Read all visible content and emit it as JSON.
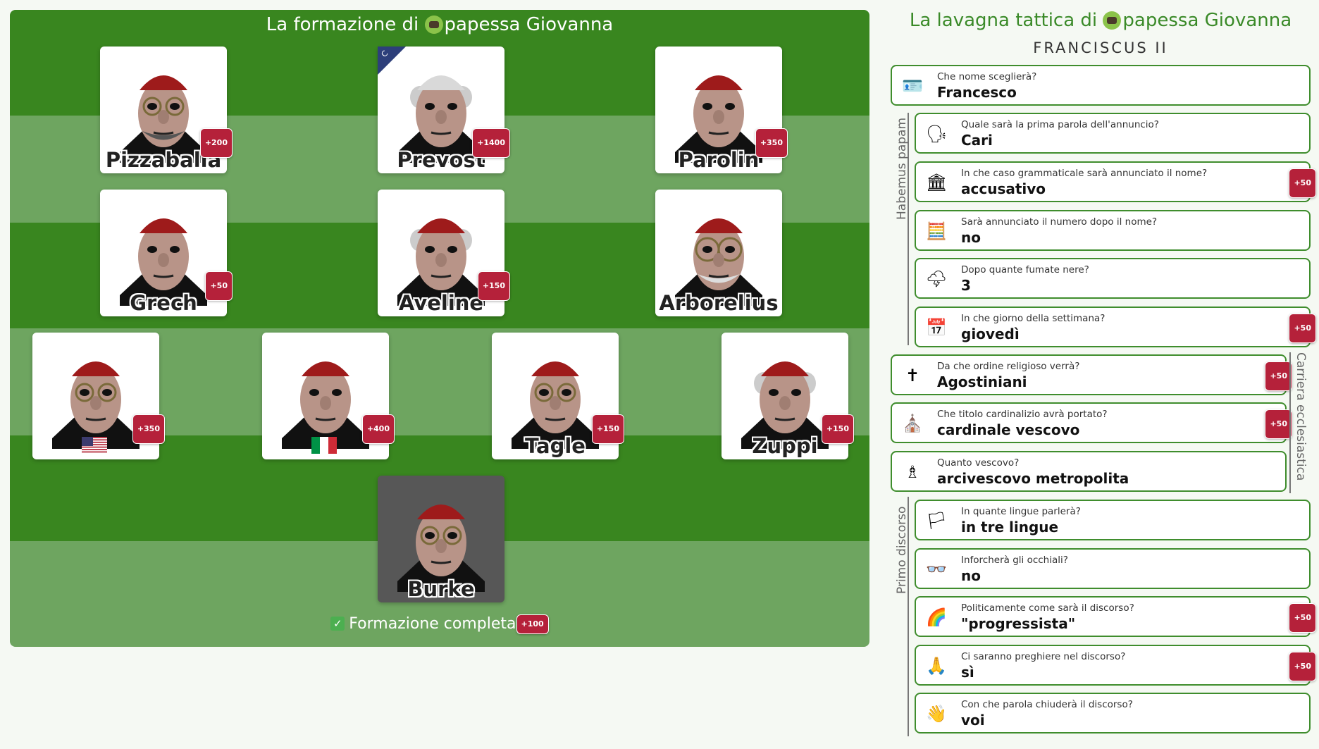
{
  "formation": {
    "title": "La formazione di ",
    "owner": "papessa Giovanna",
    "complete_label": "Formazione completa",
    "complete_badge": "+100",
    "players": [
      {
        "name": "Pizzaballa",
        "badge": "+200"
      },
      {
        "name": "Prevost",
        "badge": "+1400",
        "corner": "C"
      },
      {
        "name": "Parolin",
        "badge": "+350"
      },
      {
        "name": "Grech",
        "badge": "+50"
      },
      {
        "name": "Aveline",
        "badge": "+150"
      },
      {
        "name": "Arborelius",
        "badge": ""
      },
      {
        "name": "",
        "badge": "+350",
        "flag": "usa-flag"
      },
      {
        "name": "",
        "badge": "+400",
        "flag": "italy-flag"
      },
      {
        "name": "Tagle",
        "badge": "+150"
      },
      {
        "name": "Zuppi",
        "badge": "+150"
      },
      {
        "name": "Burke",
        "badge": ""
      }
    ]
  },
  "board": {
    "title": "La lavagna tattica di ",
    "owner": "papessa Giovanna",
    "subtitle": "FRANCISCUS II",
    "groups": {
      "habemus": "Habemus papam",
      "carriera": "Carriera ecclesiastica",
      "discorso": "Primo discorso"
    },
    "questions": [
      {
        "icon": "id-card-icon",
        "glyph": "🪪",
        "label": "Che nome sceglierà?",
        "value": "Francesco",
        "badge": ""
      },
      {
        "icon": "speaking-head-icon",
        "glyph": "🗣",
        "label": "Quale sarà la prima parola dell'annuncio?",
        "value": "Cari",
        "badge": ""
      },
      {
        "icon": "classical-building-icon",
        "glyph": "🏛",
        "label": "In che caso grammaticale sarà annunciato il nome?",
        "value": "accusativo",
        "badge": "+50"
      },
      {
        "icon": "abacus-icon",
        "glyph": "🧮",
        "label": "Sarà annunciato il numero dopo il nome?",
        "value": "no",
        "badge": ""
      },
      {
        "icon": "storm-cloud-icon",
        "glyph": "🌩",
        "label": "Dopo quante fumate nere?",
        "value": "3",
        "badge": ""
      },
      {
        "icon": "calendar-icon",
        "glyph": "📅",
        "label": "In che giorno della settimana?",
        "value": "giovedì",
        "badge": "+50"
      },
      {
        "icon": "latin-cross-icon",
        "glyph": "✝",
        "label": "Da che ordine religioso verrà?",
        "value": "Agostiniani",
        "badge": "+50"
      },
      {
        "icon": "church-icon",
        "glyph": "⛪",
        "label": "Che titolo cardinalizio avrà portato?",
        "value": "cardinale vescovo",
        "badge": "+50"
      },
      {
        "icon": "bishop-icon",
        "glyph": "♗",
        "label": "Quanto vescovo?",
        "value": "arcivescovo metropolita",
        "badge": ""
      },
      {
        "icon": "vatican-flag-icon",
        "glyph": "🏳",
        "label": "In quante lingue parlerà?",
        "value": "in tre lingue",
        "badge": ""
      },
      {
        "icon": "glasses-icon",
        "glyph": "👓",
        "label": "Inforcherà gli occhiali?",
        "value": "no",
        "badge": ""
      },
      {
        "icon": "rainbow-icon",
        "glyph": "🌈",
        "label": "Politicamente come sarà il discorso?",
        "value": "\"progressista\"",
        "badge": "+50"
      },
      {
        "icon": "praying-hands-icon",
        "glyph": "🙏",
        "label": "Ci saranno preghiere nel discorso?",
        "value": "sì",
        "badge": "+50"
      },
      {
        "icon": "waving-hand-icon",
        "glyph": "👋",
        "label": "Con che parola chiuderà il discorso?",
        "value": "voi",
        "badge": ""
      }
    ]
  }
}
